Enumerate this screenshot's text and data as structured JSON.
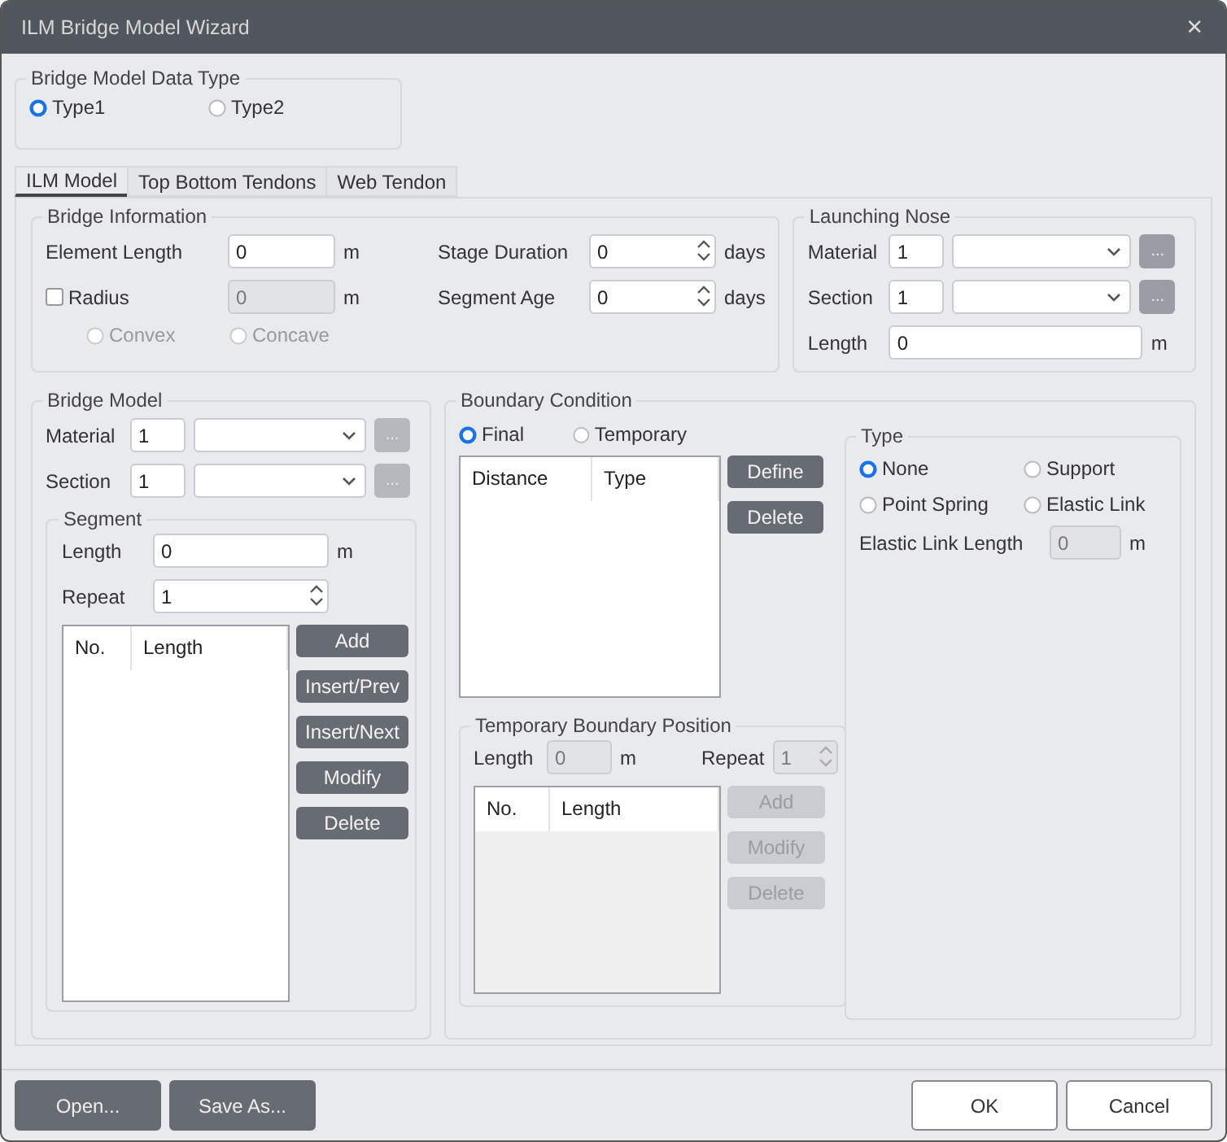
{
  "window": {
    "title": "ILM Bridge Model Wizard",
    "close": "×"
  },
  "data_type": {
    "label": "Bridge Model Data Type",
    "options": [
      {
        "label": "Type1",
        "selected": true
      },
      {
        "label": "Type2",
        "selected": false
      }
    ]
  },
  "tabs": [
    {
      "label": "ILM Model",
      "selected": true
    },
    {
      "label": "Top Bottom Tendons",
      "selected": false
    },
    {
      "label": "Web Tendon",
      "selected": false
    }
  ],
  "bridge_info": {
    "label": "Bridge Information",
    "element_length": {
      "label": "Element Length",
      "value": "0",
      "unit": "m"
    },
    "radius": {
      "label": "Radius",
      "checked": false,
      "value": "0",
      "unit": "m",
      "disabled": true
    },
    "curve": [
      {
        "label": "Convex",
        "selected": false,
        "disabled": true
      },
      {
        "label": "Concave",
        "selected": false,
        "disabled": true
      }
    ],
    "stage_duration": {
      "label": "Stage Duration",
      "value": "0",
      "unit": "days"
    },
    "segment_age": {
      "label": "Segment Age",
      "value": "0",
      "unit": "days"
    }
  },
  "launching_nose": {
    "label": "Launching Nose",
    "material": {
      "label": "Material",
      "value": "1",
      "browse": "..."
    },
    "section": {
      "label": "Section",
      "value": "1",
      "browse": "..."
    },
    "length": {
      "label": "Length",
      "value": "0",
      "unit": "m"
    }
  },
  "bridge_model": {
    "label": "Bridge Model",
    "material": {
      "label": "Material",
      "value": "1",
      "browse": "..."
    },
    "section": {
      "label": "Section",
      "value": "1",
      "browse": "..."
    },
    "segment": {
      "label": "Segment",
      "length": {
        "label": "Length",
        "value": "0",
        "unit": "m"
      },
      "repeat": {
        "label": "Repeat",
        "value": "1"
      },
      "columns": [
        "No.",
        "Length"
      ],
      "buttons": [
        {
          "label": "Add",
          "disabled": false
        },
        {
          "label": "Insert/Prev",
          "disabled": false
        },
        {
          "label": "Insert/Next",
          "disabled": false
        },
        {
          "label": "Modify",
          "disabled": false
        },
        {
          "label": "Delete",
          "disabled": false
        }
      ]
    }
  },
  "boundary": {
    "label": "Boundary Condition",
    "modes": [
      {
        "label": "Final",
        "selected": true
      },
      {
        "label": "Temporary",
        "selected": false
      }
    ],
    "columns": [
      "Distance",
      "Type"
    ],
    "buttons": [
      {
        "label": "Define",
        "disabled": false
      },
      {
        "label": "Delete",
        "disabled": false
      }
    ],
    "temporary": {
      "label": "Temporary Boundary Position",
      "disabled": true,
      "length": {
        "label": "Length",
        "value": "0",
        "unit": "m"
      },
      "repeat": {
        "label": "Repeat",
        "value": "1"
      },
      "columns": [
        "No.",
        "Length"
      ],
      "buttons": [
        {
          "label": "Add",
          "disabled": true
        },
        {
          "label": "Modify",
          "disabled": true
        },
        {
          "label": "Delete",
          "disabled": true
        }
      ]
    },
    "type": {
      "label": "Type",
      "options": [
        {
          "label": "None",
          "selected": true
        },
        {
          "label": "Support",
          "selected": false
        },
        {
          "label": "Point Spring",
          "selected": false
        },
        {
          "label": "Elastic Link",
          "selected": false
        }
      ],
      "elastic_length": {
        "label": "Elastic Link Length",
        "value": "0",
        "unit": "m",
        "disabled": true
      }
    }
  },
  "footer": {
    "left": [
      "Open...",
      "Save As..."
    ],
    "right": [
      "OK",
      "Cancel"
    ]
  }
}
